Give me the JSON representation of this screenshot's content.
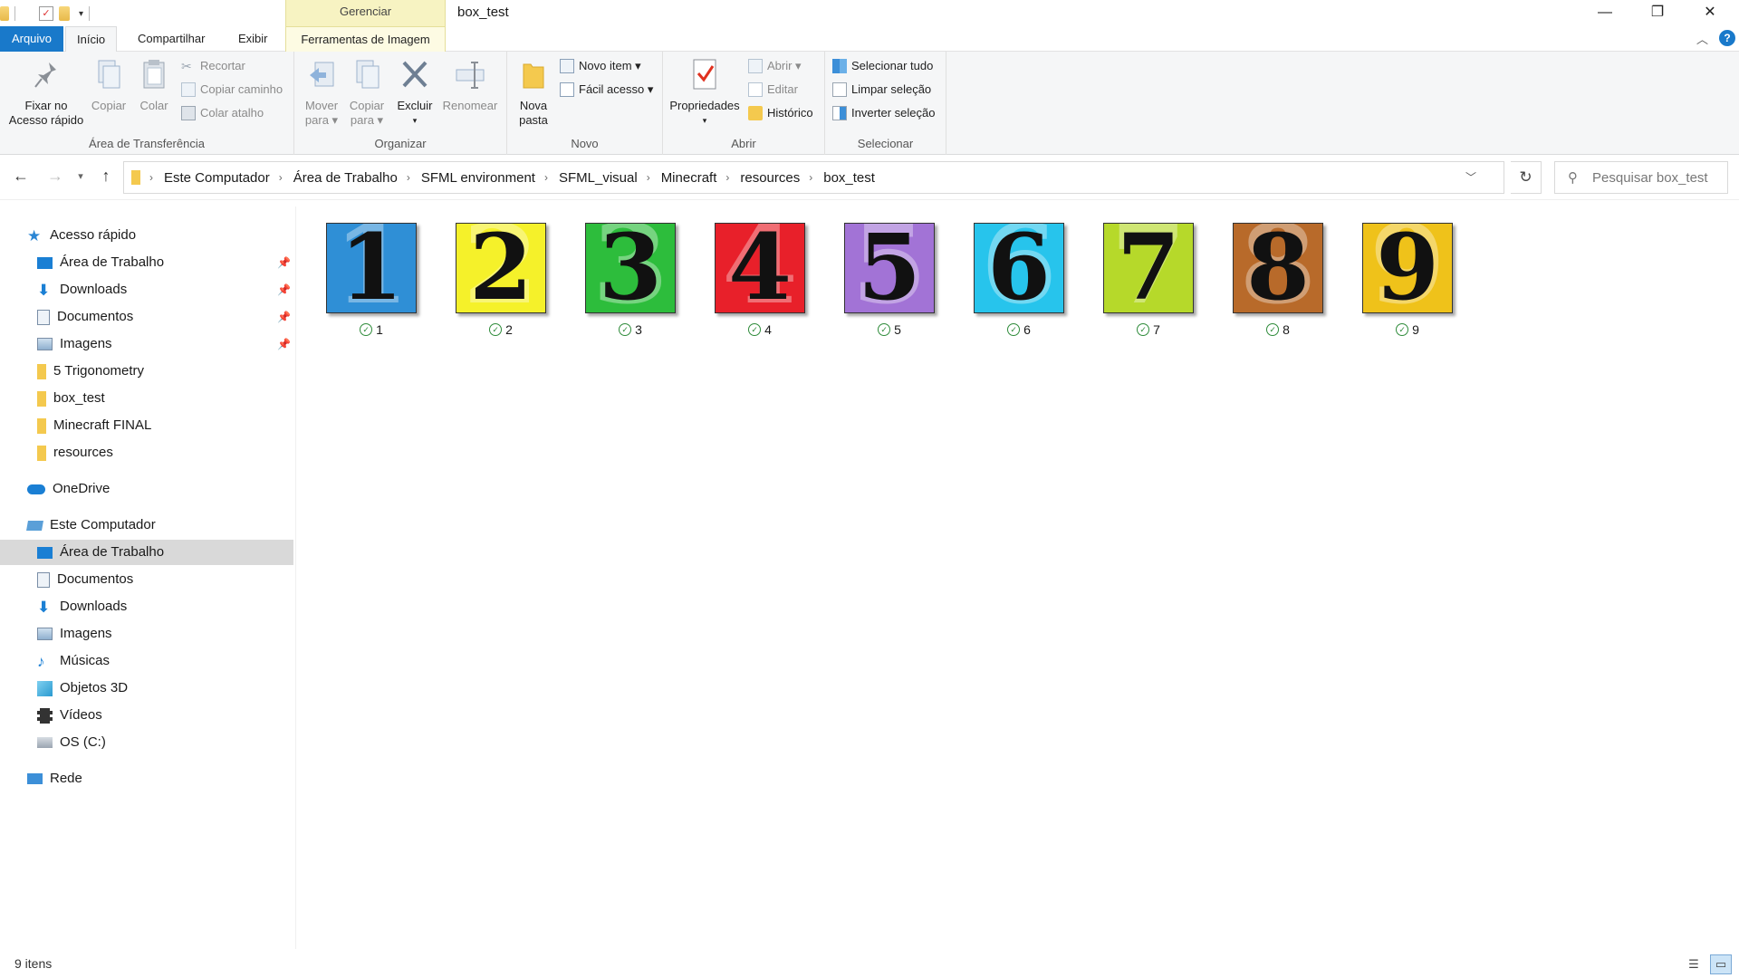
{
  "window": {
    "title": "box_test",
    "contextual_group": "Gerenciar"
  },
  "window_controls": {
    "minimize": "—",
    "maximize": "❐",
    "close": "✕"
  },
  "ribbon_tabs": [
    {
      "label": "Arquivo"
    },
    {
      "label": "Início"
    },
    {
      "label": "Compartilhar"
    },
    {
      "label": "Exibir"
    },
    {
      "label": "Ferramentas de Imagem"
    }
  ],
  "ribbon": {
    "clipboard": {
      "label": "Área de Transferência",
      "pin_label": "Fixar no\nAcesso rápido",
      "copy": "Copiar",
      "paste": "Colar",
      "cut": "Recortar",
      "copy_path": "Copiar caminho",
      "paste_shortcut": "Colar atalho"
    },
    "organize": {
      "label": "Organizar",
      "move_to": "Mover\npara ▾",
      "copy_to": "Copiar\npara ▾",
      "delete": "Excluir",
      "rename": "Renomear"
    },
    "new": {
      "label": "Novo",
      "new_folder": "Nova\npasta",
      "new_item": "Novo item ▾",
      "easy_access": "Fácil acesso ▾"
    },
    "open": {
      "label": "Abrir",
      "properties": "Propriedades",
      "open": "Abrir ▾",
      "edit": "Editar",
      "history": "Histórico"
    },
    "select": {
      "label": "Selecionar",
      "select_all": "Selecionar tudo",
      "select_none": "Limpar seleção",
      "invert": "Inverter seleção"
    }
  },
  "address": {
    "crumbs": [
      "Este Computador",
      "Área de Trabalho",
      "SFML environment",
      "SFML_visual",
      "Minecraft",
      "resources",
      "box_test"
    ]
  },
  "search": {
    "placeholder": "Pesquisar box_test"
  },
  "sidebar": {
    "quick_access": "Acesso rápido",
    "quick_items": [
      {
        "label": "Área de Trabalho",
        "pinned": true
      },
      {
        "label": "Downloads",
        "pinned": true
      },
      {
        "label": "Documentos",
        "pinned": true
      },
      {
        "label": "Imagens",
        "pinned": true
      },
      {
        "label": "5 Trigonometry"
      },
      {
        "label": "box_test"
      },
      {
        "label": "Minecraft FINAL"
      },
      {
        "label": "resources"
      }
    ],
    "onedrive": "OneDrive",
    "this_pc": "Este Computador",
    "pc_items": [
      {
        "label": "Área de Trabalho"
      },
      {
        "label": "Documentos"
      },
      {
        "label": "Downloads"
      },
      {
        "label": "Imagens"
      },
      {
        "label": "Músicas"
      },
      {
        "label": "Objetos 3D"
      },
      {
        "label": "Vídeos"
      },
      {
        "label": "OS (C:)"
      }
    ],
    "network": "Rede"
  },
  "files": [
    {
      "name": "1",
      "digit": "1",
      "color": "#2f8fd6"
    },
    {
      "name": "2",
      "digit": "2",
      "color": "#f5f12a"
    },
    {
      "name": "3",
      "digit": "3",
      "color": "#2dbd3c"
    },
    {
      "name": "4",
      "digit": "4",
      "color": "#e8202a"
    },
    {
      "name": "5",
      "digit": "5",
      "color": "#a273d6"
    },
    {
      "name": "6",
      "digit": "6",
      "color": "#27c4ec"
    },
    {
      "name": "7",
      "digit": "7",
      "color": "#b6d92a"
    },
    {
      "name": "8",
      "digit": "8",
      "color": "#b86a2a"
    },
    {
      "name": "9",
      "digit": "9",
      "color": "#efc21a"
    }
  ],
  "status": {
    "item_count": "9 itens"
  }
}
